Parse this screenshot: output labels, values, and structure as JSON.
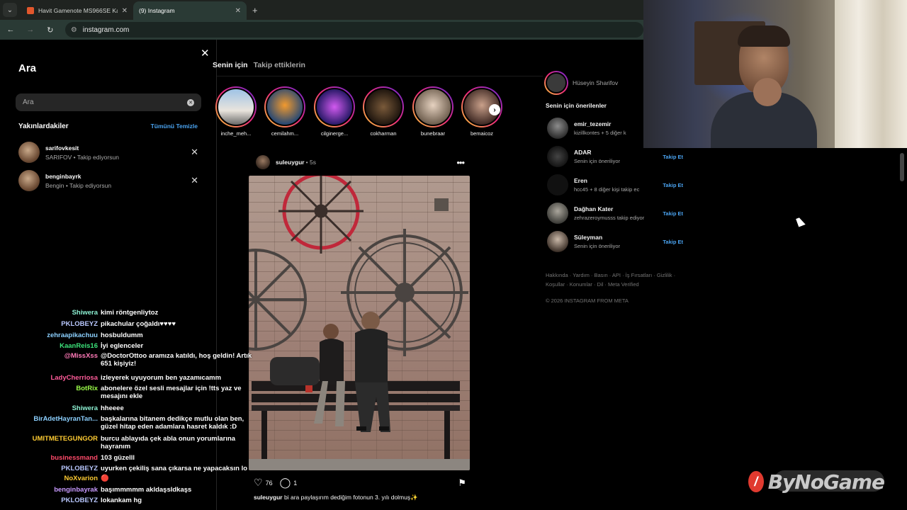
{
  "browser": {
    "tabs": [
      {
        "title": "Havit Gamenote MS966SE Kablo",
        "active": false
      },
      {
        "title": "(9) Instagram",
        "active": true
      }
    ],
    "url": "instagram.com"
  },
  "search_panel": {
    "title": "Ara",
    "placeholder": "Ara",
    "recent_title": "Yakınlardakiler",
    "clear_all": "Tümünü Temizle",
    "recent": [
      {
        "username": "sarifovkesit",
        "subtitle": "SARIFOV • Takip ediyorsun"
      },
      {
        "username": "benginbayrk",
        "subtitle": "Bengin • Takip ediyorsun"
      }
    ]
  },
  "feed_tabs": {
    "for_you": "Senin için",
    "following": "Takip ettiklerin"
  },
  "stories": [
    "inche_meh...",
    "cemilahm...",
    "cilginerge...",
    "cokharman",
    "bunebraar",
    "bemaicoz"
  ],
  "post": {
    "username": "suleuygur",
    "time": "• 5s",
    "likes": "76",
    "comments": "1",
    "caption_user": "suleuygur",
    "caption_text": "bi ara paylaşırım dediğim fotonun 3. yılı dolmuş✨"
  },
  "sidebar": {
    "me_name": "Hüseyin Sharifov",
    "suggestions_title": "Senin için önerilenler",
    "suggestions": [
      {
        "username": "emir_tezemir",
        "subtitle": "kizillkontes + 5 diğer k",
        "follow": ""
      },
      {
        "username": "ADAR",
        "subtitle": "Senin için öneriliyor",
        "follow": "Takip Et"
      },
      {
        "username": "Eren",
        "subtitle": "hcc45 + 8 diğer kişi takip ec",
        "follow": "Takip Et"
      },
      {
        "username": "Dağhan Kater",
        "subtitle": "zehrazeroymusss takip ediyor",
        "follow": "Takip Et"
      },
      {
        "username": "Süleyman",
        "subtitle": "Senin için öneriliyor",
        "follow": "Takip Et"
      }
    ],
    "footer_links": "Hakkında · Yardım · Basın · API · İş Fırsatları · Gizlilik · Koşullar · Konumlar · Dil · Meta Verified",
    "copyright": "© 2026 INSTAGRAM FROM META"
  },
  "chat": [
    {
      "user": "Shiwera",
      "text": "kimi röntgenliytoz",
      "color": "#8cf0d2"
    },
    {
      "user": "PKLOBEYZ",
      "text": "pikachular çoğaldı♥♥♥♥",
      "color": "#b9c8ff"
    },
    {
      "user": "zehraapikachuu",
      "text": "hosbuldumm",
      "color": "#8cd0ff"
    },
    {
      "user": "KaanReis16",
      "text": "İyi eglenceler",
      "color": "#3ce37a"
    },
    {
      "user": "@MissXss",
      "text": "@DoctorOttoo aramıza katıldı, hoş geldin! Artık 651 kişiyiz!",
      "color": "#ff7ab8"
    },
    {
      "user": "LadyCherriosa",
      "text": "izleyerek uyuyorum ben yazamıcamm",
      "color": "#ff5c9a"
    },
    {
      "user": "BotRix",
      "text": "abonelere özel sesli mesajlar için !tts yaz ve mesajını ekle",
      "color": "#9cff4a"
    },
    {
      "user": "Shiwera",
      "text": "hheeee",
      "color": "#8cf0d2"
    },
    {
      "user": "BirAdetHayranTan...",
      "text": "başkalarına bitanem dedikçe mutlu olan ben, güzel hitap eden adamlara hasret kaldık :D",
      "color": "#8cd0ff"
    },
    {
      "user": "UMITMETEGUNGOR",
      "text": "burcu ablayıda çek abla onun yorumlarına hayranım",
      "color": "#ffcc33"
    },
    {
      "user": "businessmand",
      "text": "103 güzelll",
      "color": "#ff4a6a"
    },
    {
      "user": "PKLOBEYZ",
      "text": "uyurken çekiliş sana çıkarsa ne yapacaksın lo",
      "color": "#b9c8ff"
    },
    {
      "user": "NoXvarion",
      "text": "🔴",
      "color": "#ffcc33"
    },
    {
      "user": "benginbayrak",
      "text": "başımmmmm akldaşsldkaşs",
      "color": "#c89aff"
    },
    {
      "user": "PKLOBEYZ",
      "text": "lokankam hg",
      "color": "#b9c8ff"
    }
  ],
  "watermark": "ByNoGame"
}
